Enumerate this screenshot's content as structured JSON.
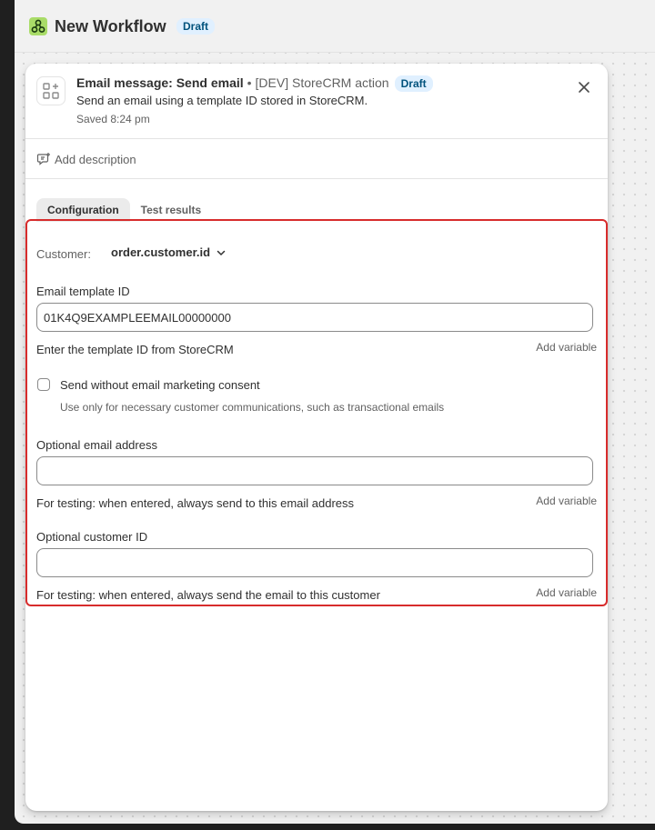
{
  "workflow": {
    "title": "New Workflow",
    "status_badge": "Draft",
    "app_icon": "workflow-app-icon"
  },
  "panel": {
    "title": "Email message: Send email",
    "separator": "•",
    "source": "[DEV] StoreCRM action",
    "status_badge": "Draft",
    "description": "Send an email using a template ID stored in StoreCRM.",
    "saved": "Saved 8:24 pm",
    "action_icon": "grid-add-icon",
    "close_icon": "close-icon",
    "add_description": "Add description",
    "add_description_icon": "comment-add-icon"
  },
  "tabs": [
    {
      "label": "Configuration",
      "active": true
    },
    {
      "label": "Test results",
      "active": false
    }
  ],
  "config": {
    "customer_label": "Customer:",
    "customer_value": "order.customer.id",
    "template_field": {
      "label": "Email template ID",
      "value": "01K4Q9EXAMPLEEMAIL00000000",
      "help": "Enter the template ID from StoreCRM",
      "add_variable": "Add variable"
    },
    "consent": {
      "label": "Send without email marketing consent",
      "help": "Use only for necessary customer communications, such as transactional emails",
      "checked": false
    },
    "email_field": {
      "label": "Optional email address",
      "value": "",
      "help": "For testing: when entered, always send to this email address",
      "add_variable": "Add variable"
    },
    "customer_field": {
      "label": "Optional customer ID",
      "value": "",
      "help": "For testing: when entered, always send the email to this customer",
      "add_variable": "Add variable"
    }
  },
  "colors": {
    "badge_bg": "#e0f0ff",
    "badge_text": "#00527c",
    "highlight_border": "#d72c2c",
    "app_icon_bg": "#a9dc68"
  }
}
